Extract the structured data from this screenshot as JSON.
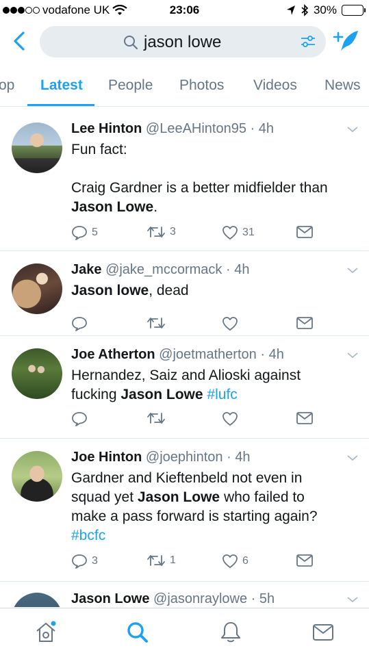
{
  "status": {
    "carrier": "vodafone UK",
    "time": "23:06",
    "battery": "30%"
  },
  "search": {
    "query": "jason lowe"
  },
  "tabs": [
    {
      "label": "op"
    },
    {
      "label": "Latest"
    },
    {
      "label": "People"
    },
    {
      "label": "Photos"
    },
    {
      "label": "Videos"
    },
    {
      "label": "News"
    }
  ],
  "tweets": [
    {
      "name": "Lee Hinton",
      "handle": "@LeeAHinton95",
      "sep": "·",
      "time": "4h",
      "line1": "Fun fact:",
      "line2": "Craig Gardner is a better midfielder than",
      "bold1": "Jason Lowe",
      "end1": ".",
      "replies": "5",
      "retweets": "3",
      "likes": "31"
    },
    {
      "name": "Jake",
      "handle": "@jake_mccormack",
      "sep": "·",
      "time": "4h",
      "bold1": "Jason lowe",
      "end1": ", dead"
    },
    {
      "name": "Joe Atherton",
      "handle": "@joetmatherton",
      "sep": "·",
      "time": "4h",
      "line1": "Hernandez, Saiz and Alioski against",
      "pre2": "fucking ",
      "bold1": "Jason Lowe",
      "hashtag": "#lufc"
    },
    {
      "name": "Joe Hinton",
      "handle": "@joephinton",
      "sep": "·",
      "time": "4h",
      "line1": "Gardner and Kieftenbeld not even in",
      "pre2": "squad yet ",
      "bold1": "Jason Lowe",
      "end1": " who failed to",
      "line3": "make a pass forward is starting again?",
      "hashtag": "#bcfc",
      "replies": "3",
      "retweets": "1",
      "likes": "6"
    },
    {
      "name": "Jason Lowe",
      "handle": "@jasonraylowe",
      "sep": "·",
      "time": "5h"
    }
  ],
  "colors": {
    "accent": "#1da1f2",
    "muted": "#657786",
    "text": "#14171a"
  },
  "icons": [
    "back-icon",
    "search-icon",
    "filter-icon",
    "compose-icon",
    "reply-icon",
    "retweet-icon",
    "like-icon",
    "dm-icon",
    "chevron-down-icon",
    "home-icon",
    "explore-icon",
    "notifications-icon",
    "messages-icon"
  ]
}
